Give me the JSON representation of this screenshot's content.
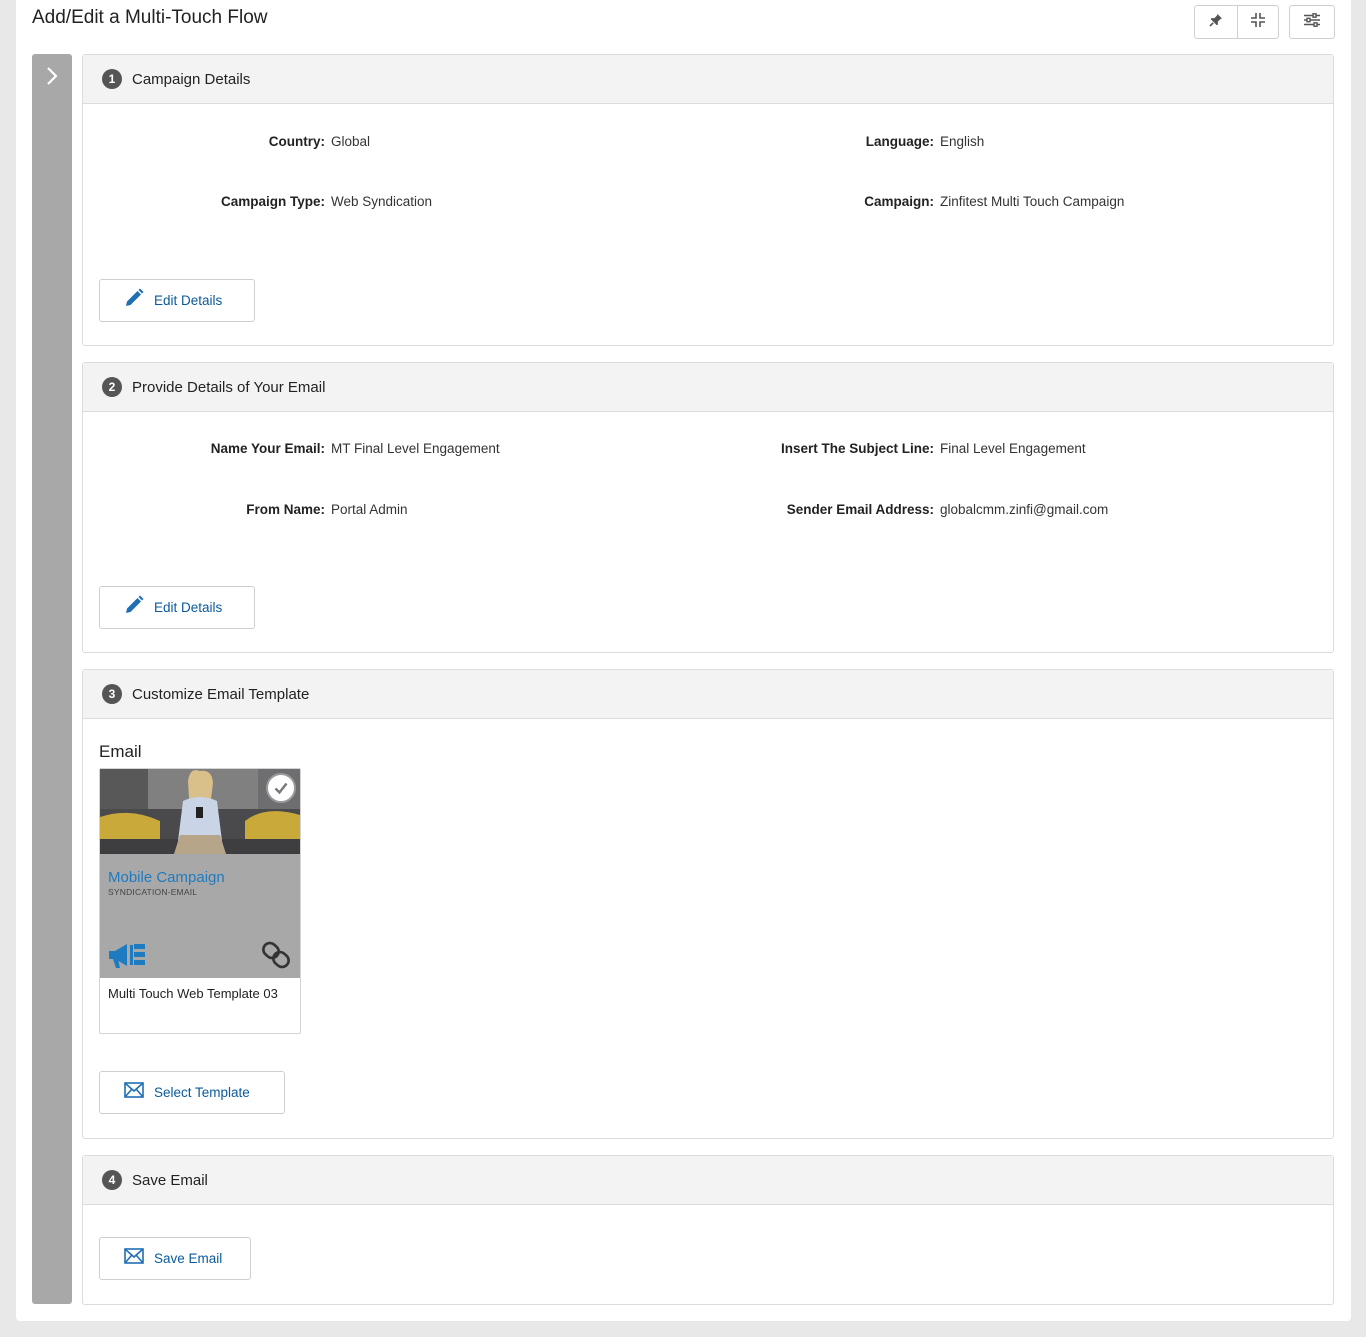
{
  "header": {
    "title": "Add/Edit a Multi-Touch Flow",
    "toolbar_icons": [
      "pin-icon",
      "collapse-icon",
      "filter-sliders-icon"
    ]
  },
  "sections": {
    "campaign": {
      "step": "1",
      "title": "Campaign Details",
      "fields": {
        "country_label": "Country:",
        "country_value": "Global",
        "language_label": "Language:",
        "language_value": "English",
        "type_label": "Campaign Type:",
        "type_value": "Web Syndication",
        "campaign_label": "Campaign:",
        "campaign_value": "Zinfitest Multi Touch Campaign"
      },
      "edit_button": "Edit Details"
    },
    "email": {
      "step": "2",
      "title": "Provide Details of Your Email",
      "fields": {
        "name_label": "Name Your Email:",
        "name_value": "MT Final Level Engagement",
        "subject_label": "Insert The Subject Line:",
        "subject_value": "Final Level Engagement",
        "from_label": "From Name:",
        "from_value": "Portal Admin",
        "sender_label": "Sender Email Address:",
        "sender_value": "globalcmm.zinfi@gmail.com"
      },
      "edit_button": "Edit Details"
    },
    "template": {
      "step": "3",
      "title": "Customize Email Template",
      "heading": "Email",
      "card": {
        "campaign_text": "Mobile Campaign",
        "sub_text": "SYNDICATION-EMAIL",
        "name": "Multi Touch Web Template 03",
        "selected": true
      },
      "select_button": "Select Template"
    },
    "save": {
      "step": "4",
      "title": "Save Email",
      "save_button": "Save Email"
    }
  },
  "colors": {
    "accent": "#0a5a9c",
    "template_title": "#1f7bc0",
    "rail": "#a8a8a8",
    "header_bg": "#f3f3f3"
  }
}
